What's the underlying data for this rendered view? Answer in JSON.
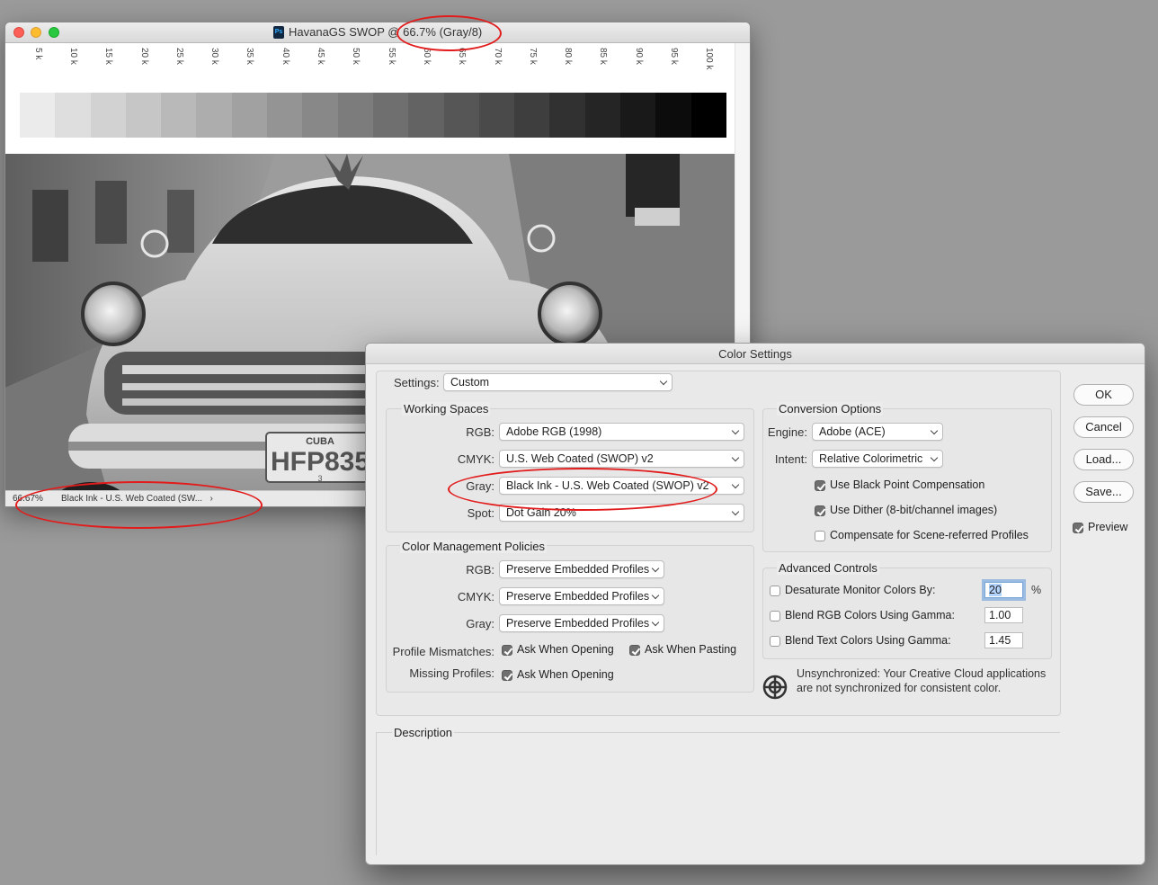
{
  "document_window": {
    "title": "HavanaGS SWOP @ 66.7% (Gray/8)",
    "app_icon_text": "Ps",
    "ruler_labels": [
      "5 k",
      "10 k",
      "15 k",
      "20 k",
      "25 k",
      "30 k",
      "35 k",
      "40 k",
      "45 k",
      "50 k",
      "55 k",
      "60 k",
      "65 k",
      "70 k",
      "75 k",
      "80 k",
      "85 k",
      "90 k",
      "95 k",
      "100 k"
    ],
    "gray_ramp_percent": [
      5,
      10,
      15,
      20,
      25,
      30,
      35,
      40,
      45,
      50,
      55,
      60,
      65,
      70,
      75,
      80,
      85,
      90,
      95,
      100
    ],
    "status": {
      "zoom": "66.67%",
      "profile": "Black Ink - U.S. Web Coated (SW...",
      "arrow": "›"
    }
  },
  "photo": {
    "plate_top": "CUBA",
    "plate_number": "HFP835",
    "plate_bottom": "3"
  },
  "dialog": {
    "title": "Color Settings",
    "settings_label": "Settings:",
    "settings_value": "Custom",
    "working_spaces": {
      "title": "Working Spaces",
      "rgb_label": "RGB:",
      "rgb_value": "Adobe RGB (1998)",
      "cmyk_label": "CMYK:",
      "cmyk_value": "U.S. Web Coated (SWOP) v2",
      "gray_label": "Gray:",
      "gray_value": "Black Ink - U.S. Web Coated (SWOP) v2",
      "spot_label": "Spot:",
      "spot_value": "Dot Gain 20%"
    },
    "policies": {
      "title": "Color Management Policies",
      "rgb_label": "RGB:",
      "rgb_value": "Preserve Embedded Profiles",
      "cmyk_label": "CMYK:",
      "cmyk_value": "Preserve Embedded Profiles",
      "gray_label": "Gray:",
      "gray_value": "Preserve Embedded Profiles",
      "mismatch_label": "Profile Mismatches:",
      "ask_opening": "Ask When Opening",
      "ask_pasting": "Ask When Pasting",
      "missing_label": "Missing Profiles:",
      "missing_ask_opening": "Ask When Opening"
    },
    "conversion": {
      "title": "Conversion Options",
      "engine_label": "Engine:",
      "engine_value": "Adobe (ACE)",
      "intent_label": "Intent:",
      "intent_value": "Relative Colorimetric",
      "bpc": "Use Black Point Compensation",
      "dither": "Use Dither (8-bit/channel images)",
      "scene": "Compensate for Scene-referred Profiles"
    },
    "advanced": {
      "title": "Advanced Controls",
      "desaturate": "Desaturate Monitor Colors By:",
      "desaturate_value": "20",
      "percent": "%",
      "blend_rgb": "Blend RGB Colors Using Gamma:",
      "blend_rgb_value": "1.00",
      "blend_text": "Blend Text Colors Using Gamma:",
      "blend_text_value": "1.45"
    },
    "sync_message": "Unsynchronized: Your Creative Cloud applications are not synchronized for consistent color.",
    "description_label": "Description",
    "buttons": {
      "ok": "OK",
      "cancel": "Cancel",
      "load": "Load...",
      "save": "Save..."
    },
    "preview_label": "Preview",
    "checkbox_states": {
      "ask_opening": true,
      "ask_pasting": true,
      "missing_ask_opening": true,
      "bpc": true,
      "dither": true,
      "scene": false,
      "desaturate": false,
      "blend_rgb": false,
      "blend_text": false,
      "preview": true
    }
  },
  "colors": {
    "annotation_red": "#e21c1c",
    "dialog_background": "#ececec",
    "close_button": "#fc5f57",
    "minimize_button": "#fdbc2e",
    "zoom_button": "#28c840"
  }
}
